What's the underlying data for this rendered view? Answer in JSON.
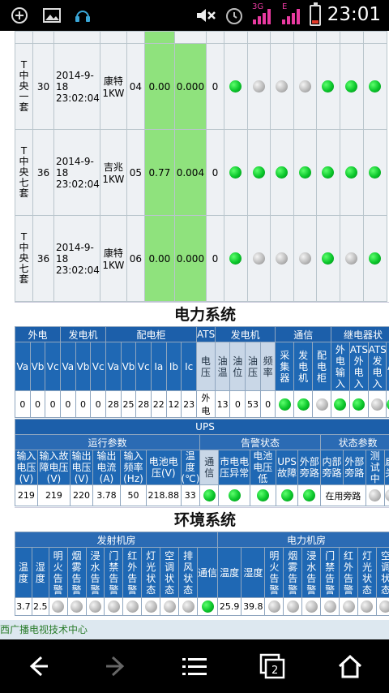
{
  "status_bar": {
    "time": "23:01",
    "net_3g": "3G",
    "net_e": "E",
    "battery_level": 0.2,
    "colors": {
      "signal": "#e83aa0",
      "battery": "#e23a2a"
    }
  },
  "tv_table": {
    "rows": [
      {
        "name": "T中央一套",
        "num": "30",
        "date": "2014-9-18",
        "time": "23:02:04",
        "maker": "康特1KW",
        "ch": "04",
        "val1": "0.00",
        "val2": "0.000",
        "flag": "0",
        "lamps": [
          "green",
          "gray",
          "gray",
          "gray",
          "green",
          "green",
          "green"
        ]
      },
      {
        "name": "T中央七套",
        "num": "36",
        "date": "2014-9-18",
        "time": "23:02:04",
        "maker": "吉兆1KW",
        "ch": "05",
        "val1": "0.77",
        "val2": "0.004",
        "flag": "0",
        "lamps": [
          "green",
          "green",
          "green",
          "green",
          "green",
          "green",
          "green"
        ]
      },
      {
        "name": "T中央七套",
        "num": "36",
        "date": "2014-9-18",
        "time": "23:02:04",
        "maker": "康特1KW",
        "ch": "06",
        "val1": "0.00",
        "val2": "0.000",
        "flag": "0",
        "lamps": [
          "green",
          "gray",
          "gray",
          "gray",
          "green",
          "gray",
          "green"
        ]
      }
    ]
  },
  "power": {
    "title": "电力系统",
    "groups": [
      "外电",
      "发电机",
      "配电柜",
      "ATS",
      "发电机",
      "通信",
      "继电器状"
    ],
    "cols": [
      "Va",
      "Vb",
      "Vc",
      "Va",
      "Vb",
      "Vc",
      "Va",
      "Vb",
      "Vc",
      "Ia",
      "Ib",
      "Ic",
      "电压",
      "油温",
      "油位",
      "油压",
      "频率",
      "采集器",
      "发电机",
      "配电柜",
      "外电输入",
      "ATS外电入",
      "ATS发电入",
      "A"
    ],
    "values": [
      "0",
      "0",
      "0",
      "0",
      "0",
      "0",
      "28",
      "25",
      "28",
      "22",
      "12",
      "23",
      "外电",
      "13",
      "0",
      "53",
      "0"
    ],
    "lamps": [
      "green",
      "green",
      "gray",
      "green",
      "green",
      "gray",
      "green"
    ]
  },
  "ups": {
    "title": "UPS",
    "groups": [
      "运行参数",
      "告警状态",
      "状态参数"
    ],
    "cols": [
      "输入电压(V)",
      "输入故障电压(V)",
      "输出电压(V)",
      "输出电流(A)",
      "输入频率(Hz)",
      "电池电压(V)",
      "温度(℃)",
      "通信",
      "市电电压异常",
      "电池电压低",
      "UPS故障",
      "外部旁路",
      "内部旁路",
      "外部旁路",
      "测试中",
      "启关"
    ],
    "values": [
      "219",
      "219",
      "220",
      "3.78",
      "50",
      "218.88",
      "33"
    ],
    "alarm_lamps": [
      "green",
      "green",
      "green",
      "green",
      "green"
    ],
    "bypass_text": "在用旁路"
  },
  "env": {
    "title": "环境系统",
    "groups": [
      "发射机房",
      "电力机房"
    ],
    "cols": [
      "温度",
      "湿度",
      "明火告警",
      "烟雾告警",
      "浸水告警",
      "门禁告警",
      "红外告警",
      "灯光状态",
      "空调状态",
      "排风状态",
      "通信",
      "温度",
      "湿度",
      "明火告警",
      "烟雾告警",
      "浸水告警",
      "门禁告警",
      "红外告警",
      "灯光状态",
      "空调状态"
    ],
    "room1": {
      "temp": "3.7",
      "hum": "2.5",
      "lamps": [
        "gray",
        "gray",
        "gray",
        "gray",
        "gray",
        "gray",
        "gray",
        "gray",
        "green"
      ]
    },
    "room2": {
      "temp": "25.9",
      "hum": "39.8",
      "lamps": [
        "gray",
        "gray",
        "gray",
        "gray",
        "gray",
        "gray",
        "gray"
      ]
    }
  },
  "footer": {
    "text": "西广播电视技术中心"
  }
}
